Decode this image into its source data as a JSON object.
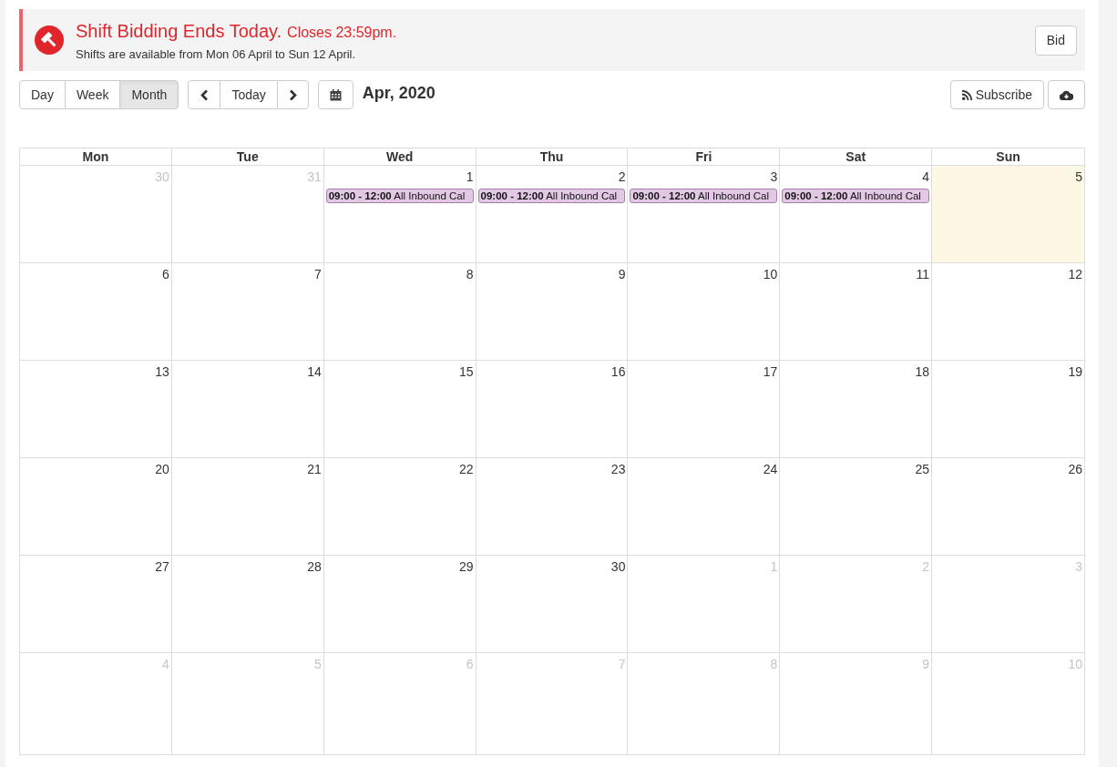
{
  "alert": {
    "title": "Shift Bidding Ends Today.",
    "subtitle": "Closes 23:59pm.",
    "message": "Shifts are available from Mon 06 April to Sun 12 April.",
    "button": "Bid"
  },
  "view_buttons": [
    {
      "label": "Day",
      "selected": false
    },
    {
      "label": "Week",
      "selected": false
    },
    {
      "label": "Month",
      "selected": true
    }
  ],
  "nav": {
    "today": "Today"
  },
  "period": "Apr, 2020",
  "subscribe": "Subscribe",
  "weekdays": [
    "Mon",
    "Tue",
    "Wed",
    "Thu",
    "Fri",
    "Sat",
    "Sun"
  ],
  "weeks": [
    [
      {
        "day": "30",
        "other_month": true,
        "today": false
      },
      {
        "day": "31",
        "other_month": true,
        "today": false
      },
      {
        "day": "1",
        "other_month": false,
        "today": false,
        "events": [
          "**09:00 - 12:00** All Inbound Cal"
        ]
      },
      {
        "day": "2",
        "other_month": false,
        "today": false,
        "events": [
          "**09:00 - 12:00** All Inbound Cal"
        ]
      },
      {
        "day": "3",
        "other_month": false,
        "today": false,
        "events": [
          "**09:00 - 12:00** All Inbound Cal"
        ]
      },
      {
        "day": "4",
        "other_month": false,
        "today": false,
        "events": [
          "**09:00 - 12:00** All Inbound Cal"
        ]
      },
      {
        "day": "5",
        "other_month": false,
        "today": true
      }
    ],
    [
      {
        "day": "6",
        "other_month": false,
        "today": false
      },
      {
        "day": "7",
        "other_month": false,
        "today": false
      },
      {
        "day": "8",
        "other_month": false,
        "today": false
      },
      {
        "day": "9",
        "other_month": false,
        "today": false
      },
      {
        "day": "10",
        "other_month": false,
        "today": false
      },
      {
        "day": "11",
        "other_month": false,
        "today": false
      },
      {
        "day": "12",
        "other_month": false,
        "today": false
      }
    ],
    [
      {
        "day": "13",
        "other_month": false,
        "today": false
      },
      {
        "day": "14",
        "other_month": false,
        "today": false
      },
      {
        "day": "15",
        "other_month": false,
        "today": false
      },
      {
        "day": "16",
        "other_month": false,
        "today": false
      },
      {
        "day": "17",
        "other_month": false,
        "today": false
      },
      {
        "day": "18",
        "other_month": false,
        "today": false
      },
      {
        "day": "19",
        "other_month": false,
        "today": false
      }
    ],
    [
      {
        "day": "20",
        "other_month": false,
        "today": false
      },
      {
        "day": "21",
        "other_month": false,
        "today": false
      },
      {
        "day": "22",
        "other_month": false,
        "today": false
      },
      {
        "day": "23",
        "other_month": false,
        "today": false
      },
      {
        "day": "24",
        "other_month": false,
        "today": false
      },
      {
        "day": "25",
        "other_month": false,
        "today": false
      },
      {
        "day": "26",
        "other_month": false,
        "today": false
      }
    ],
    [
      {
        "day": "27",
        "other_month": false,
        "today": false
      },
      {
        "day": "28",
        "other_month": false,
        "today": false
      },
      {
        "day": "29",
        "other_month": false,
        "today": false
      },
      {
        "day": "30",
        "other_month": false,
        "today": false
      },
      {
        "day": "1",
        "other_month": true,
        "today": false
      },
      {
        "day": "2",
        "other_month": true,
        "today": false
      },
      {
        "day": "3",
        "other_month": true,
        "today": false
      }
    ],
    [
      {
        "day": "4",
        "other_month": true,
        "today": false
      },
      {
        "day": "5",
        "other_month": true,
        "today": false
      },
      {
        "day": "6",
        "other_month": true,
        "today": false
      },
      {
        "day": "7",
        "other_month": true,
        "today": false
      },
      {
        "day": "8",
        "other_month": true,
        "today": false
      },
      {
        "day": "9",
        "other_month": true,
        "today": false
      },
      {
        "day": "10",
        "other_month": true,
        "today": false
      }
    ]
  ]
}
